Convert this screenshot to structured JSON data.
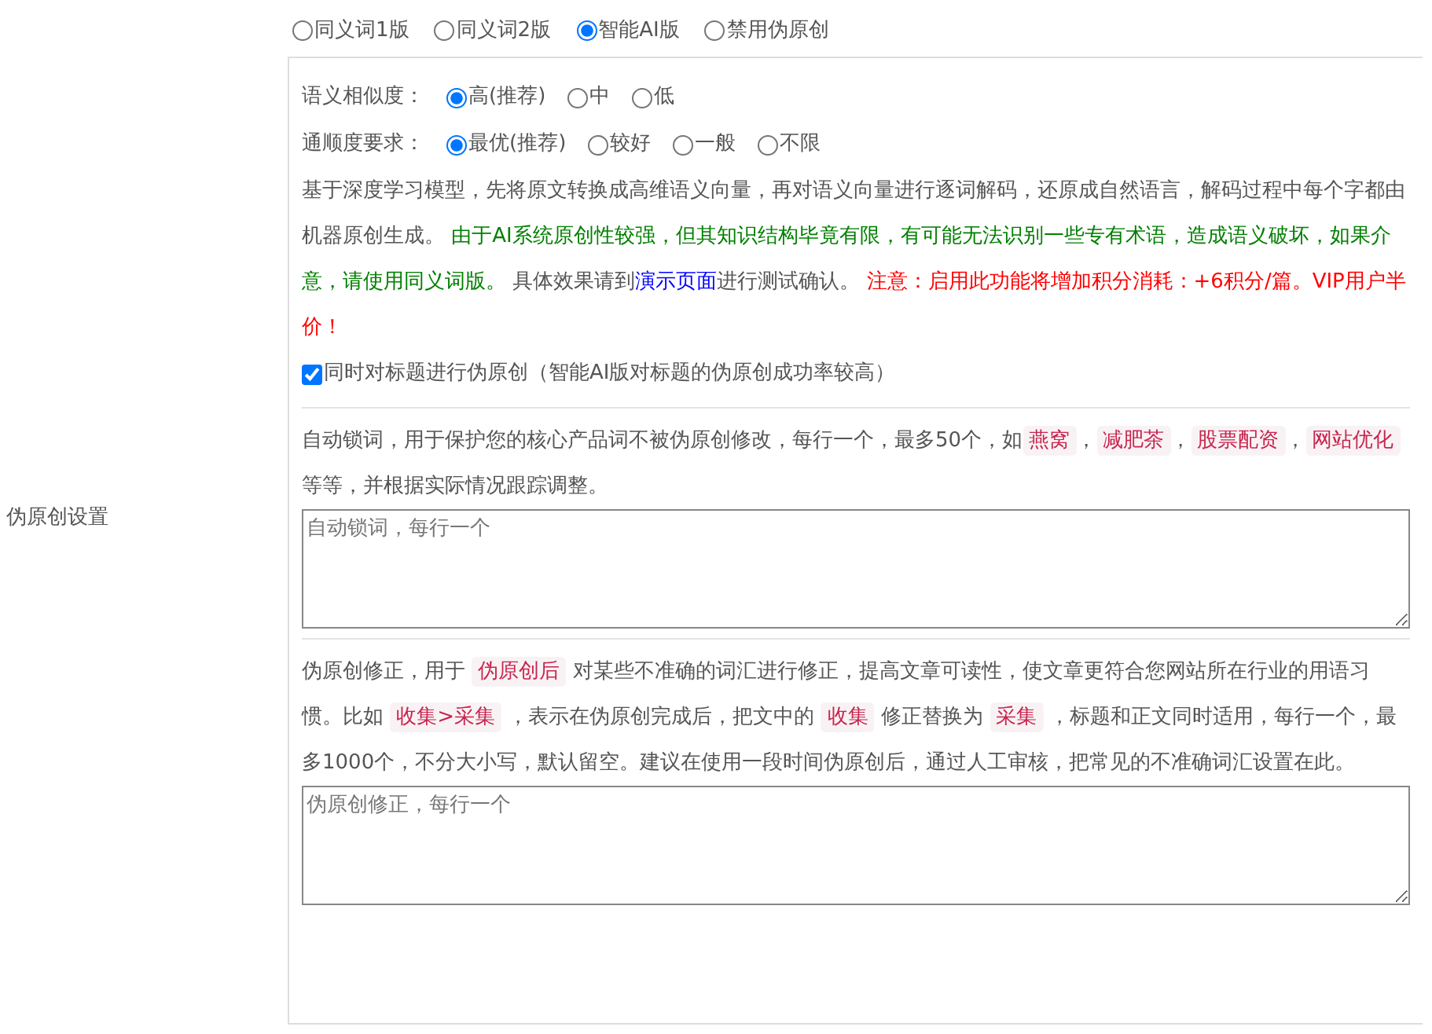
{
  "section_label": "伪原创设置",
  "modes": [
    {
      "label": "同义词1版",
      "selected": false
    },
    {
      "label": "同义词2版",
      "selected": false
    },
    {
      "label": "智能AI版",
      "selected": true
    },
    {
      "label": "禁用伪原创",
      "selected": false
    }
  ],
  "settings": [
    {
      "label": "语义相似度：",
      "options": [
        {
          "label": "高(推荐)",
          "selected": true
        },
        {
          "label": "中",
          "selected": false
        },
        {
          "label": "低",
          "selected": false
        }
      ]
    },
    {
      "label": "通顺度要求：",
      "options": [
        {
          "label": "最优(推荐)",
          "selected": true
        },
        {
          "label": "较好",
          "selected": false
        },
        {
          "label": "一般",
          "selected": false
        },
        {
          "label": "不限",
          "selected": false
        }
      ]
    }
  ],
  "description": [
    {
      "kind": "plain",
      "text": "基于深度学习模型，先将原文转换成高维语义向量，再对语义向量进行逐词解码，还原成自然语言，解码过程中每个字都由机器原创生成。 "
    },
    {
      "kind": "success",
      "text": "由于AI系统原创性较强，但其知识结构毕竟有限，有可能无法识别一些专有术语，造成语义破坏，如果介意，请使用同义词版。"
    },
    {
      "kind": "plain",
      "text": " 具体效果请到"
    },
    {
      "kind": "link",
      "text": "演示页面"
    },
    {
      "kind": "plain",
      "text": "进行测试确认。 "
    },
    {
      "kind": "warning",
      "text": "注意：启用此功能将增加积分消耗：+6积分/篇。VIP用户半价！"
    }
  ],
  "title_option": {
    "label": "同时对标题进行伪原创（智能AI版对标题的伪原创成功率较高）",
    "checked": true
  },
  "lock_words": {
    "description": [
      {
        "kind": "plain",
        "text": "自动锁词，用于保护您的核心产品词不被伪原创修改，每行一个，最多50个，如"
      },
      {
        "kind": "code",
        "text": "燕窝"
      },
      {
        "kind": "plain",
        "text": "，"
      },
      {
        "kind": "code",
        "text": "减肥茶"
      },
      {
        "kind": "plain",
        "text": "，"
      },
      {
        "kind": "code",
        "text": "股票配资"
      },
      {
        "kind": "plain",
        "text": "，"
      },
      {
        "kind": "code",
        "text": "网站优化"
      },
      {
        "kind": "plain",
        "text": " 等等，并根据实际情况跟踪调整。"
      }
    ],
    "placeholder": "自动锁词，每行一个"
  },
  "corrections": {
    "description": [
      {
        "kind": "plain",
        "text": "伪原创修正，用于 "
      },
      {
        "kind": "code",
        "text": "伪原创后"
      },
      {
        "kind": "plain",
        "text": " 对某些不准确的词汇进行修正，提高文章可读性，使文章更符合您网站所在行业的用语习惯。比如 "
      },
      {
        "kind": "code",
        "text": "收集>采集"
      },
      {
        "kind": "plain",
        "text": " ，表示在伪原创完成后，把文中的 "
      },
      {
        "kind": "code",
        "text": "收集"
      },
      {
        "kind": "plain",
        "text": " 修正替换为 "
      },
      {
        "kind": "code",
        "text": "采集"
      },
      {
        "kind": "plain",
        "text": " ，标题和正文同时适用，每行一个，最多1000个，不分大小写，默认留空。建议在使用一段时间伪原创后，通过人工审核，把常见的不准确词汇设置在此。"
      }
    ],
    "placeholder": "伪原创修正，每行一个"
  }
}
